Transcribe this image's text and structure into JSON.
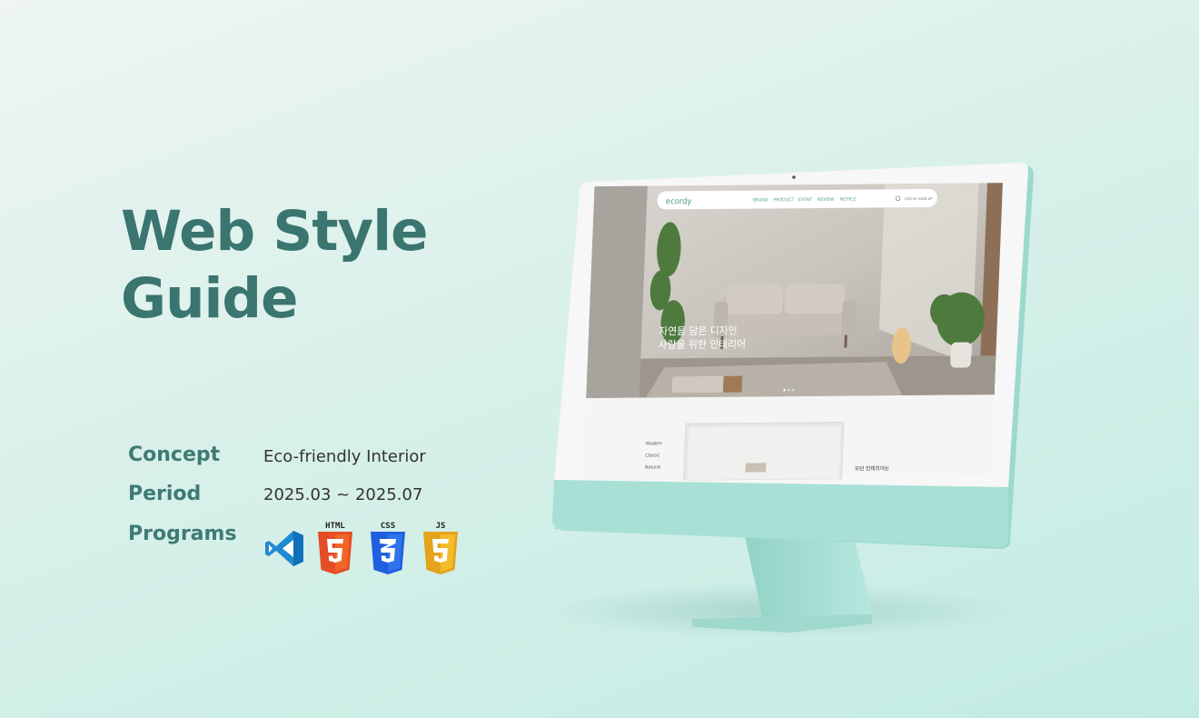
{
  "hero": {
    "title_line1": "Web Style",
    "title_line2": "Guide"
  },
  "meta": {
    "concept_label": "Concept",
    "concept_value": "Eco-friendly Interior",
    "period_label": "Period",
    "period_value": "2025.03 ~ 2025.07",
    "programs_label": "Programs"
  },
  "programs": [
    {
      "name": "vscode-icon",
      "label": ""
    },
    {
      "name": "html5-icon",
      "label": "HTML"
    },
    {
      "name": "css3-icon",
      "label": "CSS"
    },
    {
      "name": "js-icon",
      "label": "JS"
    }
  ],
  "screen": {
    "logo": "ecordy",
    "nav": [
      "BRAND",
      "PRODUCT",
      "EVENT",
      "REVIEW",
      "NOTICE"
    ],
    "login": "LOG IN",
    "signup": "SIGN UP",
    "hero_line1": "자연을 담은 디자인",
    "hero_line2": "사람을 위한 인테리어",
    "categories": [
      "Modern",
      "Classic",
      "Natural"
    ],
    "section_caption": "모던 인테리어는"
  },
  "colors": {
    "accent": "#3a7570",
    "monitor_body": "#a8e0d6",
    "background": "#d9f0ea"
  }
}
